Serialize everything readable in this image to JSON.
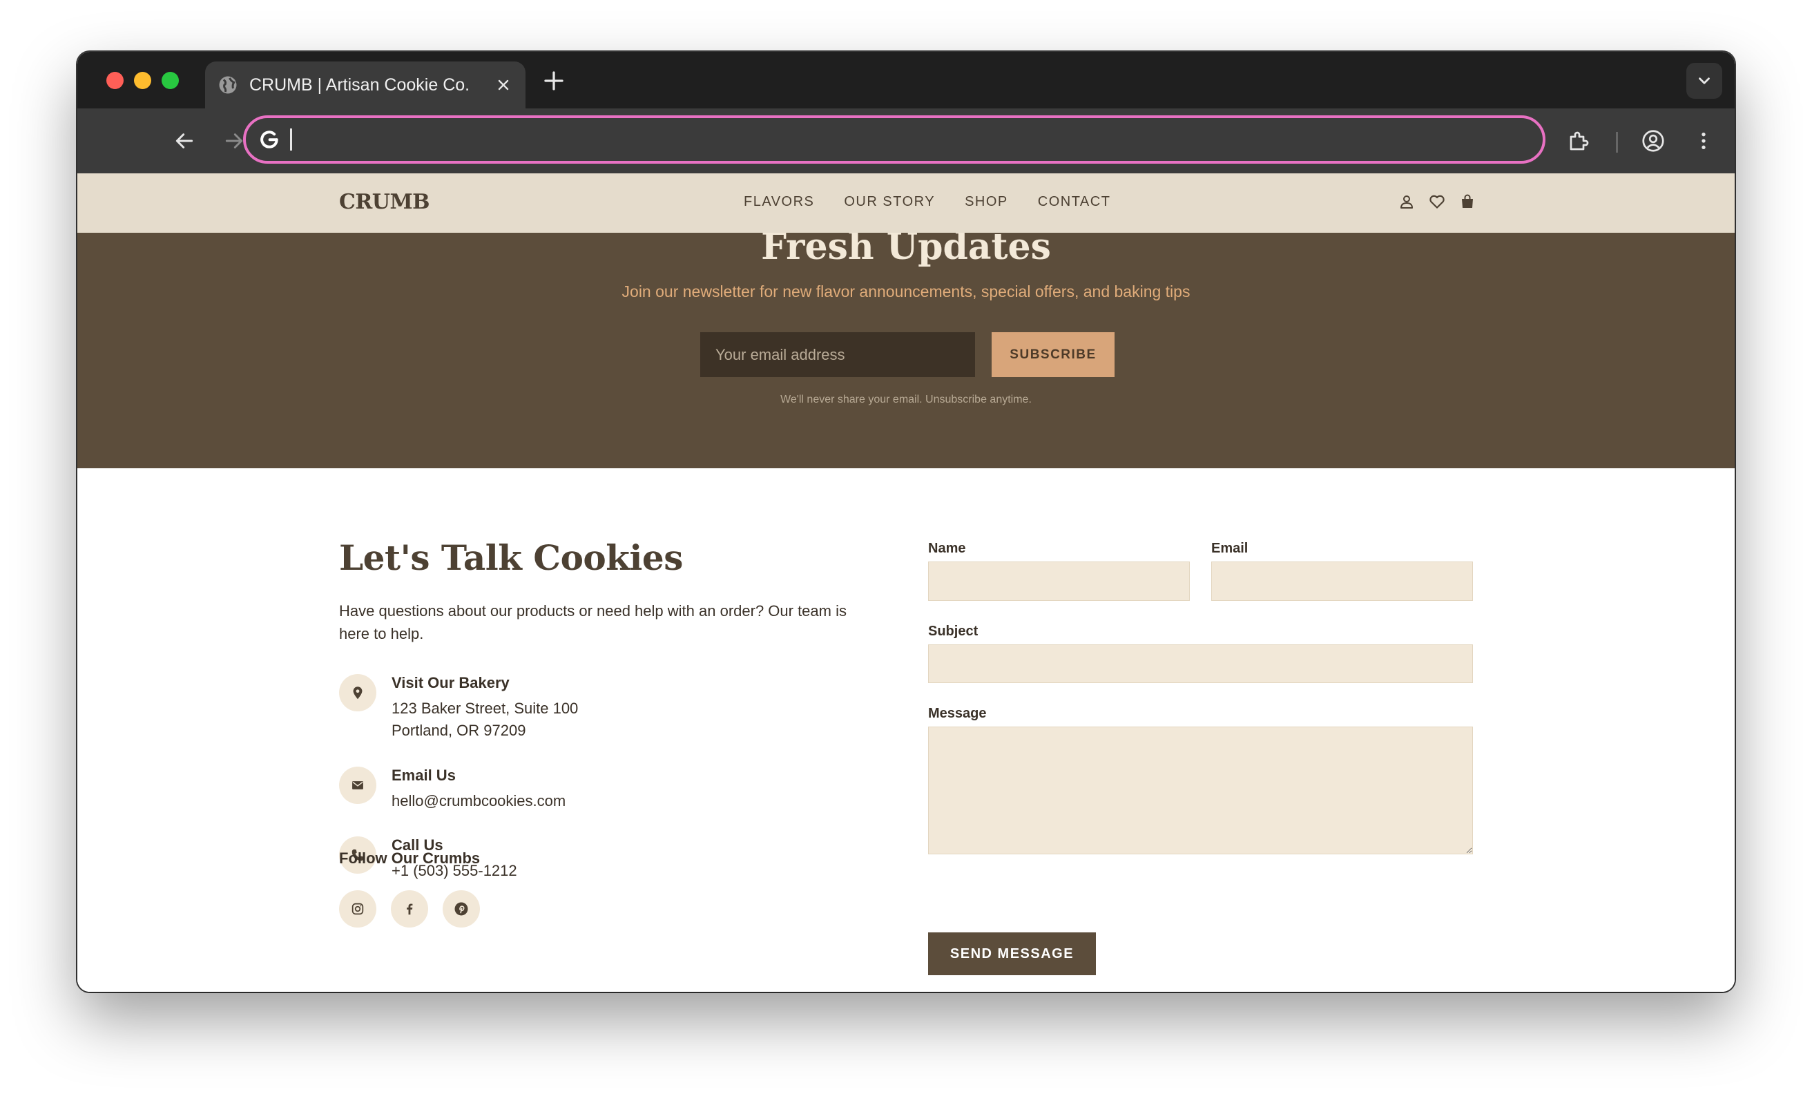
{
  "browser": {
    "tab_title": "CRUMB | Artisan Cookie Co.",
    "address_value": "",
    "accent_color": "#e871c3"
  },
  "header": {
    "logo": "CRUMB",
    "nav": [
      "FLAVORS",
      "OUR STORY",
      "SHOP",
      "CONTACT"
    ],
    "icons": [
      "user-icon",
      "heart-icon",
      "shopping-bag-icon"
    ]
  },
  "newsletter": {
    "title": "Fresh Updates",
    "subtitle": "Join our newsletter for new flavor announcements, special offers, and baking tips",
    "email_placeholder": "Your email address",
    "button": "SUBSCRIBE",
    "note": "We'll never share your email. Unsubscribe anytime."
  },
  "contact": {
    "title": "Let's Talk Cookies",
    "description": "Have questions about our products or need help with an order? Our team is here to help.",
    "items": [
      {
        "icon": "map-pin-icon",
        "title": "Visit Our Bakery",
        "lines": [
          "123 Baker Street, Suite 100",
          "Portland, OR 97209"
        ]
      },
      {
        "icon": "envelope-icon",
        "title": "Email Us",
        "lines": [
          "hello@crumbcookies.com"
        ]
      },
      {
        "icon": "phone-icon",
        "title": "Call Us",
        "lines": [
          "+1 (503) 555-1212"
        ]
      }
    ],
    "follow_title": "Follow Our Crumbs",
    "socials": [
      "instagram-icon",
      "facebook-icon",
      "pinterest-icon"
    ]
  },
  "form": {
    "name_label": "Name",
    "email_label": "Email",
    "subject_label": "Subject",
    "message_label": "Message",
    "name_value": "",
    "email_value": "",
    "subject_value": "",
    "message_value": "",
    "submit": "SEND MESSAGE"
  },
  "colors": {
    "header_bg": "#e5dccc",
    "newsletter_bg": "#5c4d3b",
    "accent": "#d8a57a",
    "field_bg": "#f2e8d8",
    "text_dark": "#4d4133"
  }
}
